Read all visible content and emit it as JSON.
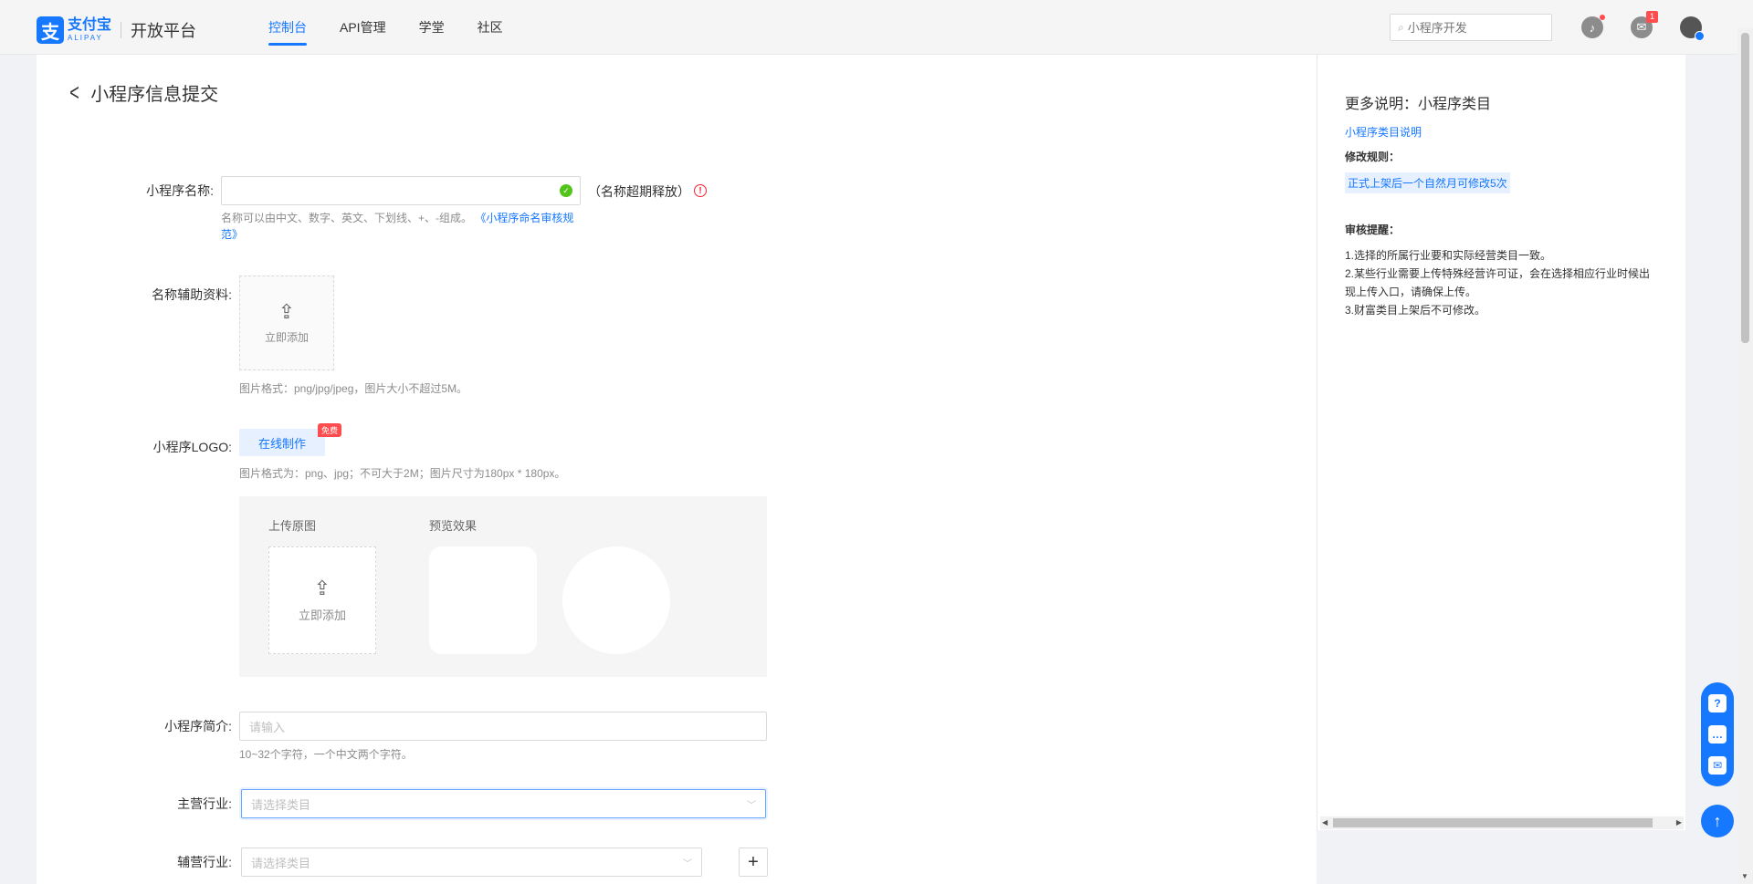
{
  "header": {
    "logo_cn": "支付宝",
    "logo_en": "ALIPAY",
    "logo_mark": "支",
    "platform": "开放平台",
    "nav": [
      {
        "label": "控制台",
        "active": true
      },
      {
        "label": "API管理",
        "active": false
      },
      {
        "label": "学堂",
        "active": false
      },
      {
        "label": "社区",
        "active": false
      }
    ],
    "search_placeholder": "小程序开发",
    "message_badge": "1",
    "icons": [
      "bell-icon",
      "message-icon",
      "avatar"
    ]
  },
  "page": {
    "title": "小程序信息提交"
  },
  "form": {
    "name": {
      "label": "小程序名称:",
      "value": "",
      "suffix": "（名称超期释放）",
      "hint_text": "名称可以由中文、数字、英文、下划线、+、-组成。",
      "hint_link": "《小程序命名审核规范》"
    },
    "aux_material": {
      "label": "名称辅助资料:",
      "upload_text": "立即添加",
      "hint": "图片格式：png/jpg/jpeg，图片大小不超过5M。"
    },
    "logo": {
      "label": "小程序LOGO:",
      "online_button": "在线制作",
      "free_tag": "免费",
      "hint": "图片格式为：png、jpg；不可大于2M；图片尺寸为180px * 180px。",
      "upload_title": "上传原图",
      "preview_title": "预览效果",
      "upload_text": "立即添加"
    },
    "intro": {
      "label": "小程序简介:",
      "placeholder": "请输入",
      "hint": "10~32个字符，一个中文两个字符。"
    },
    "main_industry": {
      "label": "主营行业:",
      "placeholder": "请选择类目"
    },
    "aux_industry": {
      "label": "辅营行业:",
      "placeholder": "请选择类目",
      "add_label": "+"
    }
  },
  "right_panel": {
    "title": "更多说明：小程序类目",
    "link": "小程序类目说明",
    "modify_rule_title": "修改规则：",
    "modify_rule": "正式上架后一个自然月可修改5次",
    "review_title": "审核提醒：",
    "review_items": [
      "1.选择的所属行业要和实际经营类目一致。",
      "2.某些行业需要上传特殊经营许可证，会在选择相应行业时候出现上传入口，请确保上传。",
      "3.财富类目上架后不可修改。"
    ]
  },
  "colors": {
    "brand": "#1677ff",
    "success": "#52c41a",
    "danger": "#ff4d4f"
  }
}
